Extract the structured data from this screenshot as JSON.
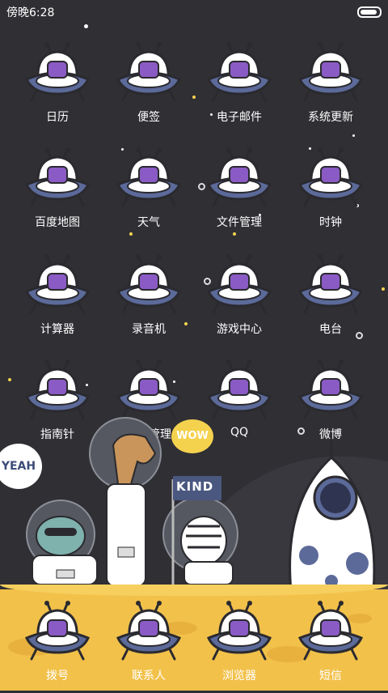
{
  "status_bar": {
    "time": "傍晚6:28",
    "battery_level": 0.9
  },
  "apps": [
    {
      "label": "日历",
      "icon": "calendar-icon"
    },
    {
      "label": "便签",
      "icon": "notes-icon"
    },
    {
      "label": "电子邮件",
      "icon": "email-icon"
    },
    {
      "label": "系统更新",
      "icon": "system-update-icon"
    },
    {
      "label": "百度地图",
      "icon": "baidu-map-icon"
    },
    {
      "label": "天气",
      "icon": "weather-icon"
    },
    {
      "label": "文件管理",
      "icon": "file-manager-icon"
    },
    {
      "label": "时钟",
      "icon": "clock-icon"
    },
    {
      "label": "计算器",
      "icon": "calculator-icon"
    },
    {
      "label": "录音机",
      "icon": "recorder-icon"
    },
    {
      "label": "游戏中心",
      "icon": "game-center-icon"
    },
    {
      "label": "电台",
      "icon": "radio-icon"
    },
    {
      "label": "指南针",
      "icon": "compass-icon"
    },
    {
      "label": "下载管理",
      "icon": "download-manager-icon"
    },
    {
      "label": "QQ",
      "icon": "qq-icon"
    },
    {
      "label": "微博",
      "icon": "weibo-icon"
    }
  ],
  "dock": [
    {
      "label": "拨号",
      "icon": "phone-icon"
    },
    {
      "label": "联系人",
      "icon": "contacts-icon"
    },
    {
      "label": "浏览器",
      "icon": "browser-icon"
    },
    {
      "label": "短信",
      "icon": "messages-icon"
    }
  ],
  "scene": {
    "bubble_yeah": "YEAH",
    "bubble_wow": "WOW",
    "flag_text": "KIND"
  },
  "colors": {
    "accent": "#8a5bc4",
    "ufo_body": "#5c6a9a",
    "ground": "#f2c14a"
  }
}
